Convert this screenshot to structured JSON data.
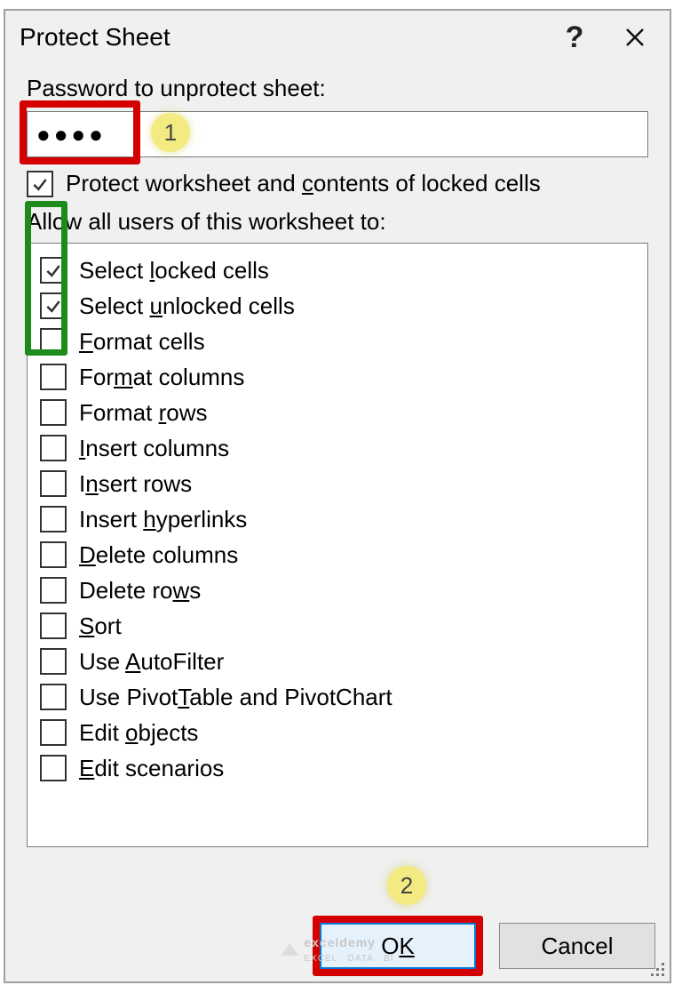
{
  "dialog": {
    "title": "Protect Sheet",
    "helpGlyph": "?",
    "password": {
      "label": "Password to unprotect sheet:",
      "value": "●●●●"
    },
    "protectCheckbox": {
      "checked": true,
      "labelParts": {
        "pre": "Protect worksheet and ",
        "acc": "c",
        "post": "ontents of locked cells"
      }
    },
    "allowLabel": "Allow all users of this worksheet to:",
    "options": [
      {
        "checked": true,
        "pre": "Select ",
        "acc": "l",
        "post": "ocked cells"
      },
      {
        "checked": true,
        "pre": "Select ",
        "acc": "u",
        "post": "nlocked cells"
      },
      {
        "checked": false,
        "pre": "",
        "acc": "F",
        "post": "ormat cells"
      },
      {
        "checked": false,
        "pre": "For",
        "acc": "m",
        "post": "at columns"
      },
      {
        "checked": false,
        "pre": "Format ",
        "acc": "r",
        "post": "ows"
      },
      {
        "checked": false,
        "pre": "",
        "acc": "I",
        "post": "nsert columns"
      },
      {
        "checked": false,
        "pre": "I",
        "acc": "n",
        "post": "sert rows"
      },
      {
        "checked": false,
        "pre": "Insert ",
        "acc": "h",
        "post": "yperlinks"
      },
      {
        "checked": false,
        "pre": "",
        "acc": "D",
        "post": "elete columns"
      },
      {
        "checked": false,
        "pre": "Delete ro",
        "acc": "w",
        "post": "s"
      },
      {
        "checked": false,
        "pre": "",
        "acc": "S",
        "post": "ort"
      },
      {
        "checked": false,
        "pre": "Use ",
        "acc": "A",
        "post": "utoFilter"
      },
      {
        "checked": false,
        "pre": "Use Pivot",
        "acc": "T",
        "post": "able and PivotChart"
      },
      {
        "checked": false,
        "pre": "Edit ",
        "acc": "o",
        "post": "bjects"
      },
      {
        "checked": false,
        "pre": "",
        "acc": "E",
        "post": "dit scenarios"
      }
    ],
    "buttons": {
      "ok": {
        "pre": "O",
        "acc": "K",
        "post": ""
      },
      "cancel": "Cancel"
    },
    "annotations": {
      "badge1": "1",
      "badge2": "2"
    },
    "watermark": {
      "brand": "exceldemy",
      "tag": "EXCEL · DATA · BI"
    }
  }
}
